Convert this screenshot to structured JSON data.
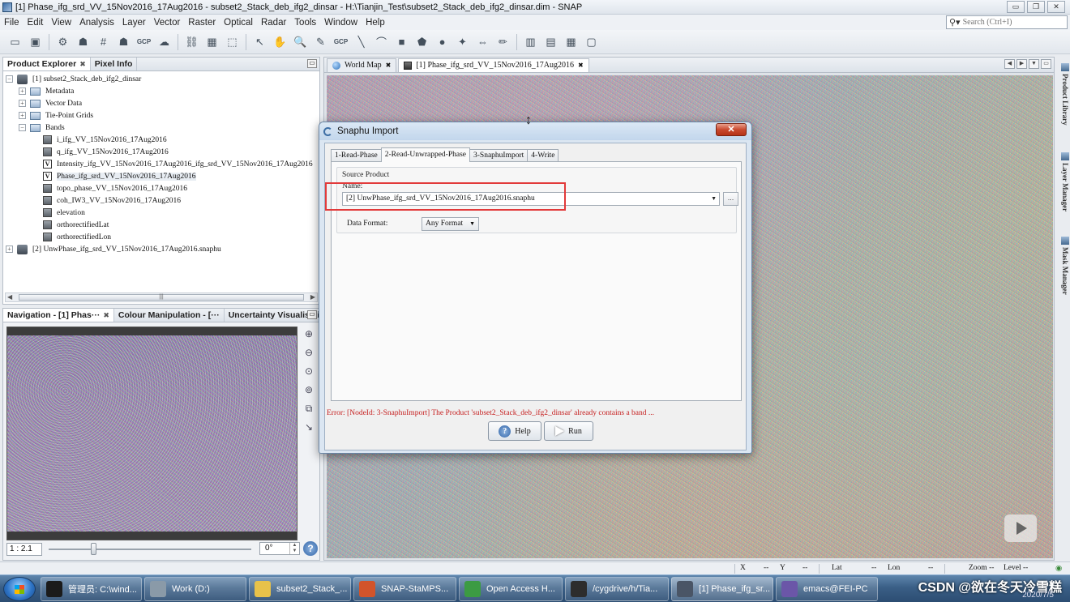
{
  "window": {
    "title": "[1] Phase_ifg_srd_VV_15Nov2016_17Aug2016 - subset2_Stack_deb_ifg2_dinsar - H:\\Tianjin_Test\\subset2_Stack_deb_ifg2_dinsar.dim - SNAP",
    "controls": [
      "▭",
      "❐",
      "✕"
    ]
  },
  "menu": [
    "File",
    "Edit",
    "View",
    "Analysis",
    "Layer",
    "Vector",
    "Raster",
    "Optical",
    "Radar",
    "Tools",
    "Window",
    "Help"
  ],
  "search": {
    "placeholder": "Search (Ctrl+I)"
  },
  "toolbar": {
    "gcp_label_1": "GCP",
    "gcp_label_2": "GCP"
  },
  "explorer": {
    "tabs": [
      "Product Explorer",
      "Pixel Info"
    ],
    "tree": {
      "product1": "[1] subset2_Stack_deb_ifg2_dinsar",
      "metadata": "Metadata",
      "vector_data": "Vector Data",
      "tie_point_grids": "Tie-Point Grids",
      "bands": "Bands",
      "band_items": [
        "i_ifg_VV_15Nov2016_17Aug2016",
        "q_ifg_VV_15Nov2016_17Aug2016",
        "Intensity_ifg_VV_15Nov2016_17Aug2016_ifg_srd_VV_15Nov2016_17Aug2016",
        "Phase_ifg_srd_VV_15Nov2016_17Aug2016",
        "topo_phase_VV_15Nov2016_17Aug2016",
        "coh_IW3_VV_15Nov2016_17Aug2016",
        "elevation",
        "orthorectifiedLat",
        "orthorectifiedLon"
      ],
      "product2": "[2] UnwPhase_ifg_srd_VV_15Nov2016_17Aug2016.snaphu"
    }
  },
  "navigation": {
    "tabs": [
      "Navigation - [1] Phas···",
      "Colour Manipulation - [···",
      "Uncertainty Visualisation"
    ],
    "zoom": "1 : 2.1",
    "angle": "0°",
    "help": "?"
  },
  "document": {
    "tabs": [
      "World Map",
      "[1] Phase_ifg_srd_VV_15Nov2016_17Aug2016"
    ]
  },
  "right_strip": [
    "Product Library",
    "Layer Manager",
    "Mask Manager"
  ],
  "statusbar": {
    "x": "X",
    "x_val": "--",
    "y": "Y",
    "y_val": "--",
    "lat": "Lat",
    "lat_val": "--",
    "lon": "Lon",
    "lon_val": "--",
    "zoom": "Zoom --",
    "level": "Level --"
  },
  "dialog": {
    "title": "Snaphu Import",
    "tabs": [
      "1-Read-Phase",
      "2-Read-Unwrapped-Phase",
      "3-SnaphuImport",
      "4-Write"
    ],
    "active_tab": 1,
    "source_product_label": "Source Product",
    "name_label": "Name:",
    "product_value": "[2] UnwPhase_ifg_srd_VV_15Nov2016_17Aug2016.snaphu",
    "browse_label": "...",
    "data_format_label": "Data Format:",
    "data_format_value": "Any Format",
    "error": "Error: [NodeId: 3-SnaphuImport] The Product 'subset2_Stack_deb_ifg2_dinsar' already contains a band ...",
    "help_button": "Help",
    "run_button": "Run"
  },
  "taskbar": {
    "tasks": [
      {
        "label": "管理员: C:\\wind...",
        "color": "#1b1b1b"
      },
      {
        "label": "Work (D:)",
        "color": "#8a9aa8"
      },
      {
        "label": "subset2_Stack_...",
        "color": "#e8c24a"
      },
      {
        "label": "SNAP-StaMPS...",
        "color": "#d2542b"
      },
      {
        "label": "Open Access H...",
        "color": "#3c9b43"
      },
      {
        "label": "/cygdrive/h/Tia...",
        "color": "#2d2d2d"
      },
      {
        "label": "[1] Phase_ifg_sr...",
        "color": "#4a5566"
      },
      {
        "label": "emacs@FEI-PC",
        "color": "#6b56a8"
      }
    ],
    "watermark": "CSDN @欲在冬天冷雪糕",
    "clock": "2020/7/5"
  },
  "colors": {
    "highlight": "#e23a3a",
    "error": "#c62020",
    "dialog_close": "#c94a2f"
  }
}
